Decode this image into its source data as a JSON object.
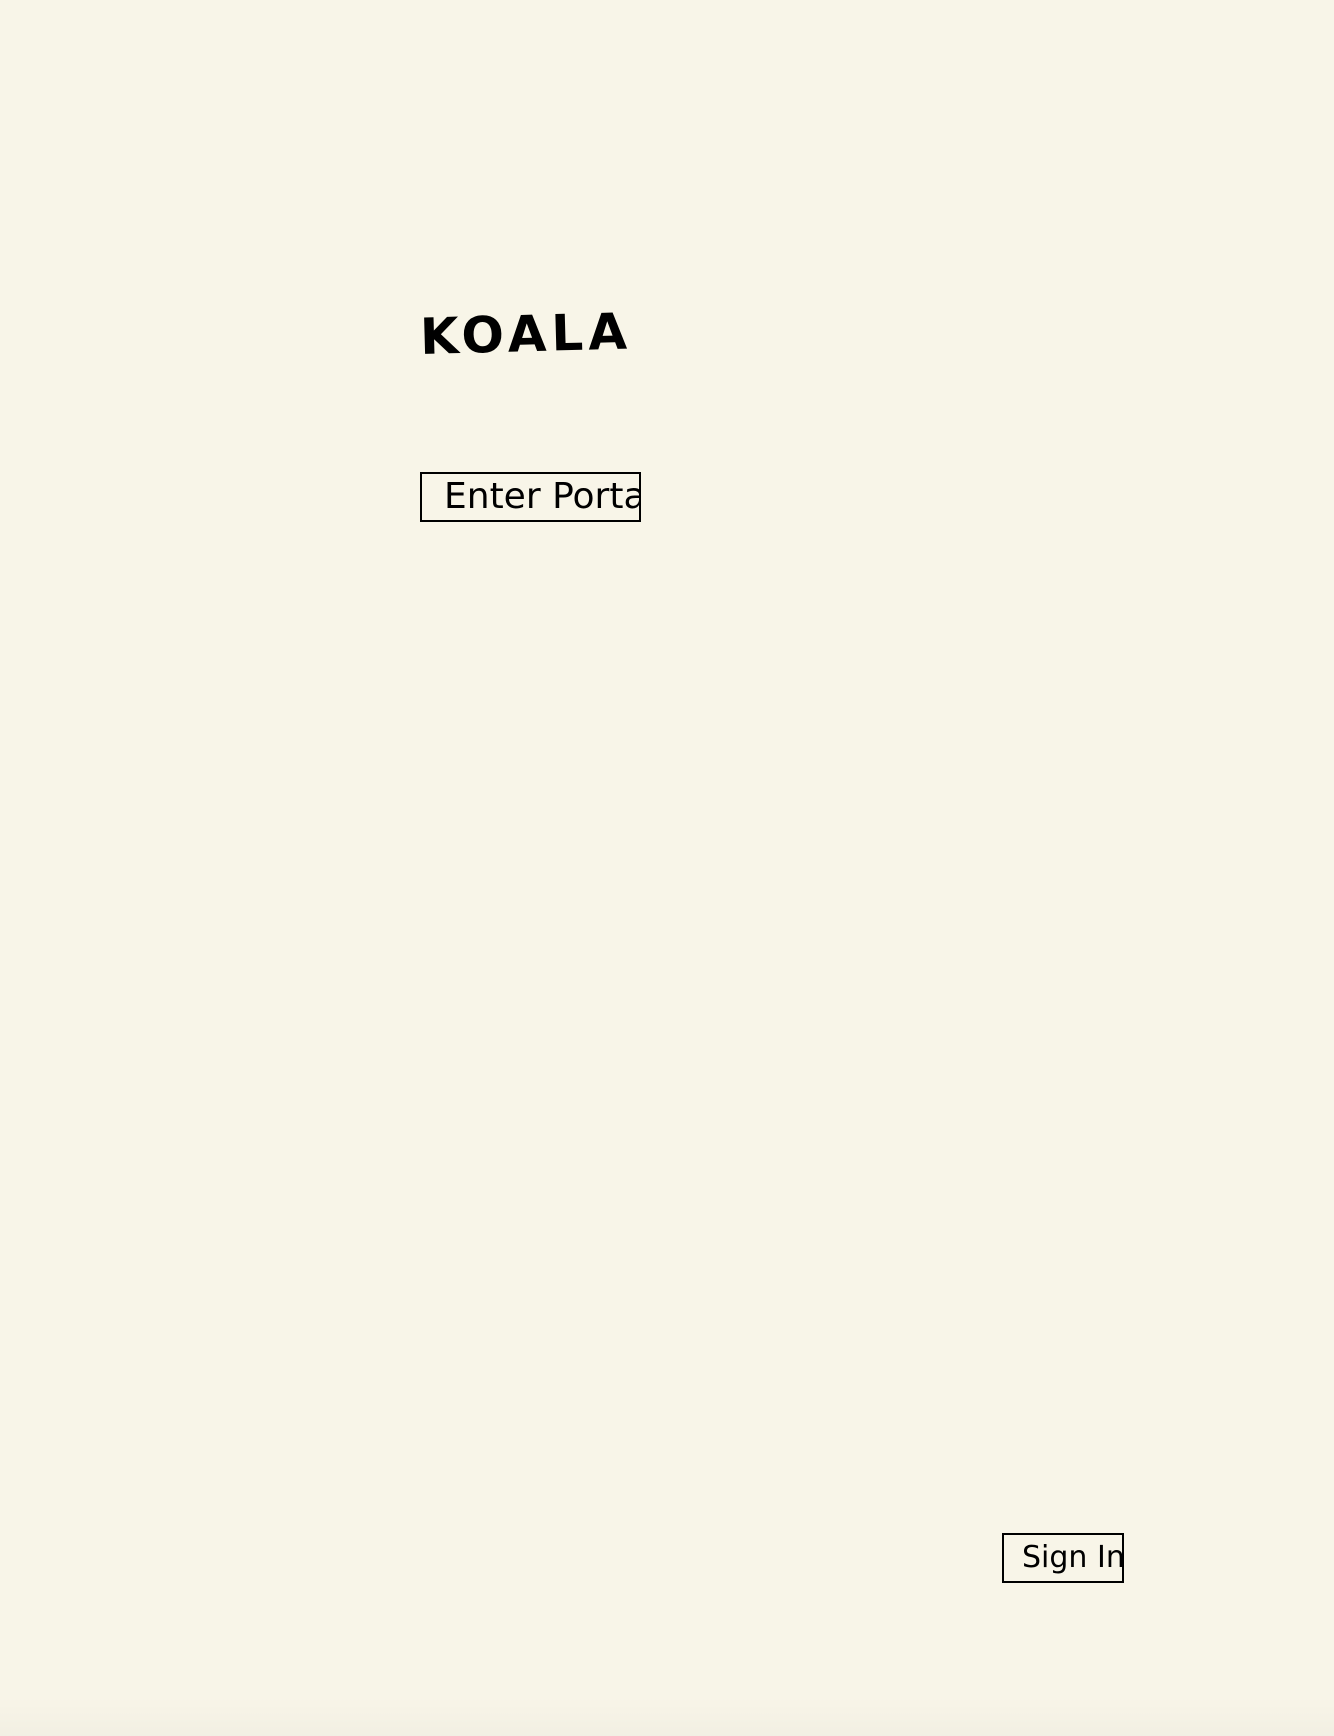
{
  "brand": {
    "name": "KOALA"
  },
  "actions": {
    "enter_portal_label": "Enter Portal",
    "sign_in_label": "Sign In"
  },
  "colors": {
    "background": "#f8f5e8",
    "ink": "#000000"
  }
}
